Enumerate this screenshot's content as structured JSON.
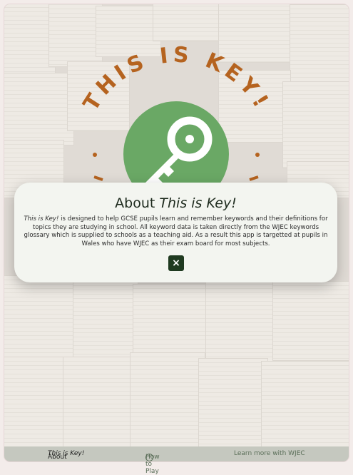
{
  "logo": {
    "arc_text": "THIS IS KEY!",
    "colors": {
      "text": "#b5631f",
      "circle": "#6aa865",
      "key": "#ffffff"
    },
    "icon": "key-icon"
  },
  "modal": {
    "title_prefix": "About ",
    "title_em": "This is Key!",
    "body_em": "This is Key!",
    "body_text": " is designed to help GCSE pupils learn and remember keywords and their definitions for topics they are studying in school. All keyword data is taken directly from the WJEC keywords glossary which is supplied to schools as a teaching aid. As a result this app is targetted at pupils in Wales who have WJEC as their exam board for most subjects.",
    "close_icon": "×"
  },
  "footer": {
    "about_prefix": "About ",
    "about_em": "This is Key!",
    "how_icon": "?",
    "how_label": "How to Play",
    "learn_label": "Learn more with WJEC"
  }
}
